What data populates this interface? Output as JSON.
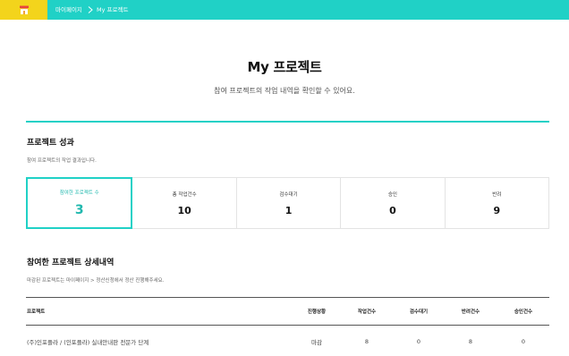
{
  "topbar": {
    "home_icon": "home-icon",
    "breadcrumb": [
      "마이페이지",
      "My 프로젝트"
    ],
    "colors": {
      "bar": "#20d1c6",
      "home": "#f3d41c"
    }
  },
  "header": {
    "title": "My 프로젝트",
    "subtitle": "참여 프로젝트의 작업 내역을 확인할 수 있어요."
  },
  "performance": {
    "title": "프로젝트 성과",
    "desc": "참여 프로젝트의 작업 결과입니다.",
    "stats": [
      {
        "label": "참여한 프로젝트 수",
        "value": "3"
      },
      {
        "label": "총 작업건수",
        "value": "10"
      },
      {
        "label": "검수대기",
        "value": "1"
      },
      {
        "label": "승인",
        "value": "0"
      },
      {
        "label": "반려",
        "value": "9"
      }
    ]
  },
  "details": {
    "title": "참여한 프로젝트 상세내역",
    "desc": "마감된 프로젝트는 마이페이지 > 정산신청에서 정산 진행해주세요.",
    "columns": [
      "프로젝트",
      "진행상황",
      "작업건수",
      "검수대기",
      "반려건수",
      "승인건수"
    ],
    "rows": [
      {
        "name": "(주)인포플라 / (인포플라) 실내안내판 전문가 단계",
        "status": "마감",
        "work": "8",
        "wait": "0",
        "rejected": "8",
        "approved": "0"
      }
    ]
  }
}
